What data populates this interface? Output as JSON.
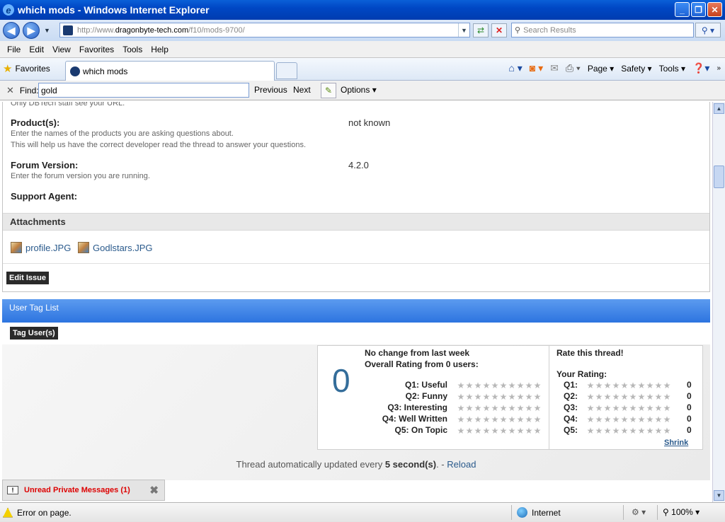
{
  "window": {
    "title": "which mods - Windows Internet Explorer"
  },
  "address": {
    "prefix": "http://www.",
    "domain": "dragonbyte-tech.com",
    "path": "/f10/mods-9700/"
  },
  "search": {
    "placeholder": "Search Results"
  },
  "menu": [
    "File",
    "Edit",
    "View",
    "Favorites",
    "Tools",
    "Help"
  ],
  "favorites": {
    "label": "Favorites"
  },
  "tab": {
    "title": "which mods"
  },
  "command_bar": {
    "page": "Page ▾",
    "safety": "Safety ▾",
    "tools": "Tools ▾"
  },
  "find": {
    "label": "Find:",
    "value": "gold",
    "previous": "Previous",
    "next": "Next",
    "options": "Options"
  },
  "page": {
    "top_cut_text": "Only DBTech staff see your URL.",
    "product_label": "Product(s):",
    "product_desc1": "Enter the names of the products you are asking questions about.",
    "product_desc2": "This will help us have the correct developer read the thread to answer your questions.",
    "product_value": "not known",
    "forum_label": "Forum Version:",
    "forum_desc": "Enter the forum version you are running.",
    "forum_value": "4.2.0",
    "agent_label": "Support Agent:",
    "attachments_heading": "Attachments",
    "attachments": [
      "profile.JPG",
      "Godlstars.JPG"
    ],
    "edit_issue": "Edit Issue",
    "user_tag_list": "User Tag List",
    "tag_users": "Tag User(s)"
  },
  "rating": {
    "overall_number": "0",
    "change": "No change from last week",
    "overall": "Overall Rating from 0 users:",
    "questions": [
      "Q1: Useful",
      "Q2: Funny",
      "Q3: Interesting",
      "Q4: Well Written",
      "Q5: On Topic"
    ],
    "rate_title": "Rate this thread!",
    "your_rating": "Your Rating:",
    "your_q": [
      "Q1:",
      "Q2:",
      "Q3:",
      "Q4:",
      "Q5:"
    ],
    "your_values": [
      "0",
      "0",
      "0",
      "0",
      "0"
    ],
    "shrink": "Shrink"
  },
  "autoupdate": {
    "prefix": "Thread automatically updated every ",
    "seconds": "5 second(s)",
    "mid": ". - ",
    "reload": "Reload"
  },
  "pm": {
    "label": "Unread Private Messages (1)"
  },
  "status": {
    "message": "Error on page.",
    "zone": "Internet",
    "zoom": "100%"
  }
}
